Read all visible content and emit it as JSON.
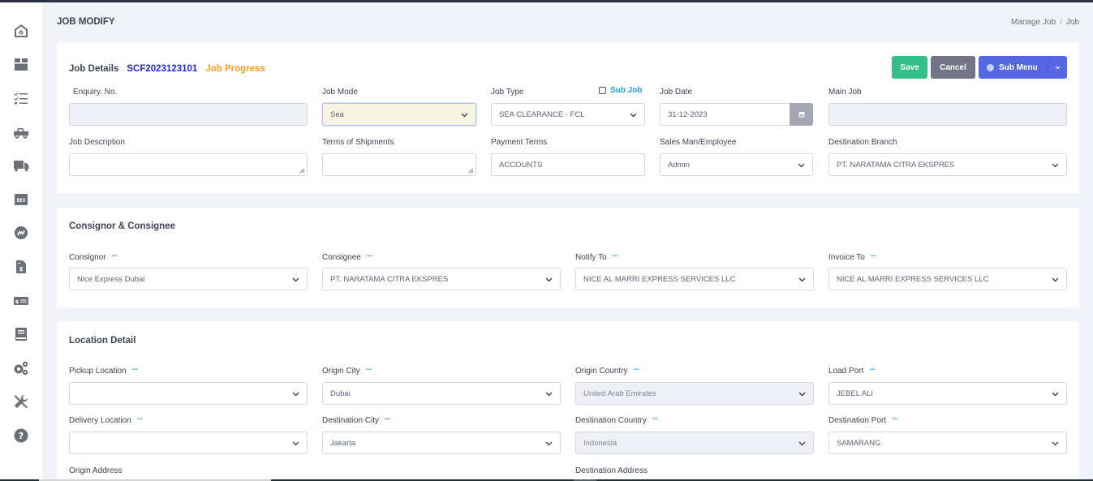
{
  "page": {
    "title": "JOB MODIFY",
    "breadcrumb": [
      "Manage Job",
      "Job"
    ]
  },
  "sidebar": {
    "items": [
      {
        "icon": "home-icon"
      },
      {
        "icon": "box-icon"
      },
      {
        "icon": "checklist-icon"
      },
      {
        "icon": "pickup-truck-icon"
      },
      {
        "icon": "delivery-truck-icon"
      },
      {
        "icon": "dev-icon"
      },
      {
        "icon": "link-circle-icon"
      },
      {
        "icon": "invoice-dollar-icon"
      },
      {
        "icon": "money-bill-icon"
      },
      {
        "icon": "book-icon"
      },
      {
        "icon": "gears-icon"
      },
      {
        "icon": "tools-icon"
      },
      {
        "icon": "help-icon"
      }
    ]
  },
  "job_details": {
    "title": "Job Details",
    "job_number": "SCF2023123101",
    "progress_link": "Job Progress",
    "actions": {
      "save": "Save",
      "cancel": "Cancel",
      "sub_menu": "Sub Menu"
    },
    "fields": {
      "enquiry_no": {
        "label": "Enquiry. No.",
        "value": ""
      },
      "job_mode": {
        "label": "Job Mode",
        "value": "Sea"
      },
      "job_type": {
        "label": "Job Type",
        "value": "SEA CLEARANCE - FCL"
      },
      "sub_job": {
        "label": "Sub Job",
        "checked": false
      },
      "job_date": {
        "label": "Job Date",
        "value": "31-12-2023"
      },
      "main_job": {
        "label": "Main Job",
        "value": ""
      },
      "job_description": {
        "label": "Job Description",
        "value": ""
      },
      "terms_of_shipments": {
        "label": "Terms of Shipments",
        "value": ""
      },
      "payment_terms": {
        "label": "Payment Terms",
        "value": "ACCOUNTS"
      },
      "sales_man": {
        "label": "Sales Man/Employee",
        "value": "Admin"
      },
      "destination_branch": {
        "label": "Destination Branch",
        "value": "PT. NARATAMA CITRA EKSPRES"
      }
    }
  },
  "consignor_consignee": {
    "title": "Consignor & Consignee",
    "more_label": "...",
    "fields": {
      "consignor": {
        "label": "Consignor",
        "value": "Nice Express Dubai"
      },
      "consignee": {
        "label": "Consignee",
        "value": "PT. NARATAMA CITRA EKSPRES"
      },
      "notify_to": {
        "label": "Notify To",
        "value": "NICE AL MARRI EXPRESS SERVICES LLC"
      },
      "invoice_to": {
        "label": "Invoice To",
        "value": "NICE AL MARRI EXPRESS SERVICES LLC"
      }
    }
  },
  "location_detail": {
    "title": "Location Detail",
    "fields": {
      "pickup_location": {
        "label": "Pickup Location",
        "value": ""
      },
      "origin_city": {
        "label": "Origin City",
        "value": "Dubai"
      },
      "origin_country": {
        "label": "Origin Country",
        "value": "United Arab Emirates"
      },
      "load_port": {
        "label": "Load Port",
        "value": "JEBEL ALI"
      },
      "delivery_location": {
        "label": "Delivery Location",
        "value": ""
      },
      "destination_city": {
        "label": "Destination City",
        "value": "Jakarta"
      },
      "destination_country": {
        "label": "Destination Country",
        "value": "Indonesia"
      },
      "destination_port": {
        "label": "Destination Port",
        "value": "SAMARANG"
      },
      "origin_address": {
        "label": "Origin Address"
      },
      "destination_address": {
        "label": "Destination Address"
      }
    }
  }
}
